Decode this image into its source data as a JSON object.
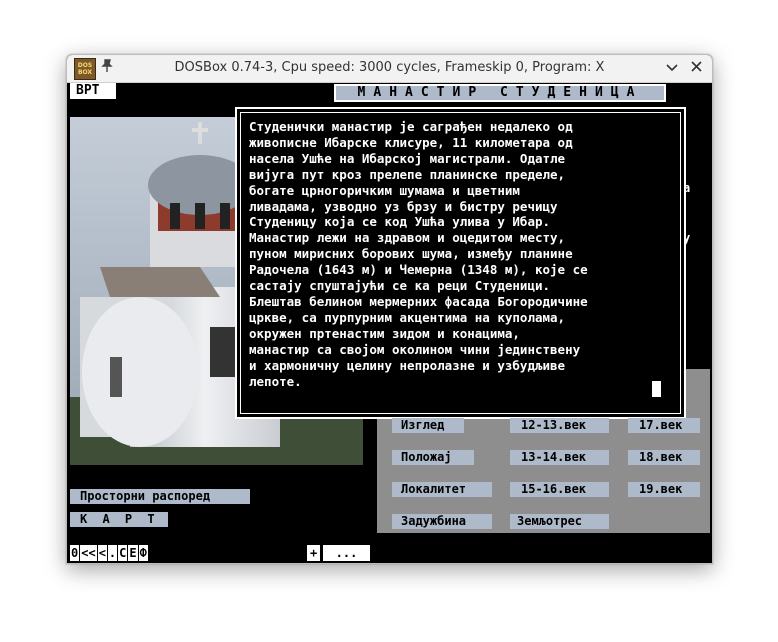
{
  "window": {
    "title": "DOSBox 0.74-3, Cpu speed: 3000 cycles, Frameskip 0, Program: X",
    "icon_text_top": "DOS",
    "icon_text_bottom": "BOX",
    "pin_icon": "pin-icon",
    "minimize_icon": "chevron-down-icon",
    "close_icon": "close-icon"
  },
  "header": {
    "channel": "ВРТ",
    "title": "МАНАСТИР СТУДЕНИЦА"
  },
  "article": {
    "text": "Студенички манастир је саграђен недалеко од\nживописне Ибарске клисуре, 11 километара од\nнасела Ушће на Ибарској магистрали. Одатле\nвијуга пут кроз прелепе планинске пределе,\nбогате црногоричким шумама и цветним\nливадама, узводно уз брзу и бистру речицу\nСтуденицу која се код Ушћа улива у Ибар.\nМанастир лежи на здравом и оцедитом месту,\nпуном мирисних борових шума, између планине\nРадочела (1643 м) и Чемерна (1348 м), које се\nсастају спуштајући се ка реци Студеници.\nБлештав белином мермерних фасада Богородичине\nцркве, са пурпурним акцентима на куполама,\nокружен пртенастим зидом и конацима,\nманастир са својом околином чини јединствену\nи хармоничну целину непролазне и узбудљиве\nлепоте."
  },
  "left_menu": {
    "spatial": "Просторни распоред",
    "map": "К А Р Т А"
  },
  "topics": [
    "Изглед",
    "Положај",
    "Локалитет",
    "Задужбина"
  ],
  "centuries_a": [
    "12-13.век",
    "13-14.век",
    "15-16.век",
    "Земљотрес"
  ],
  "centuries_b": [
    "17.век",
    "18.век",
    "19.век"
  ],
  "partial_behind": [
    "а",
    "у"
  ],
  "nav": {
    "items": [
      "0",
      "<<",
      "<",
      ".",
      "C",
      "E",
      "Ф"
    ],
    "plus": "+",
    "more": "..."
  }
}
